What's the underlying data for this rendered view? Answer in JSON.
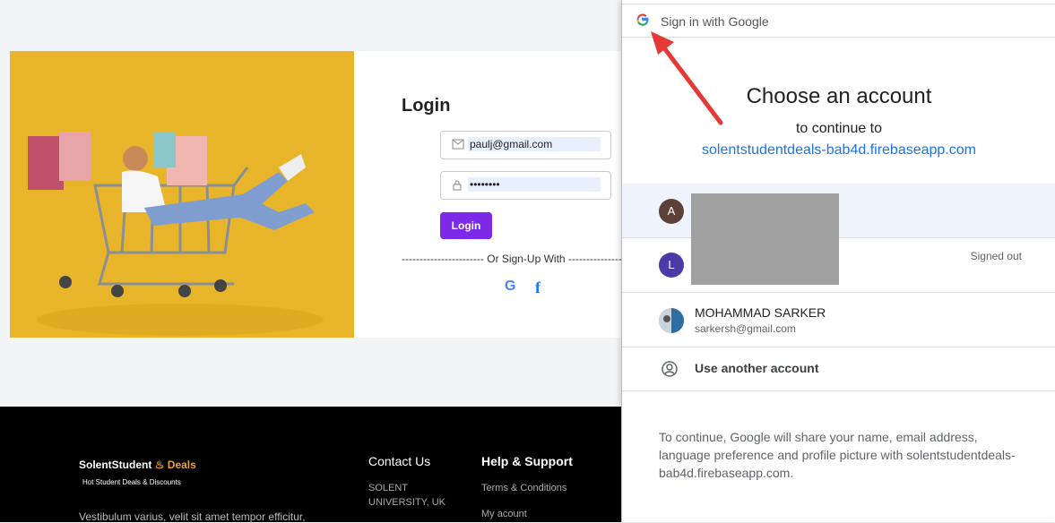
{
  "login": {
    "title": "Login",
    "email_value": "paulj@gmail.com",
    "password_value": "••••••••",
    "button_label": "Login",
    "divider": "----------------------- Or Sign-Up With ---------------------"
  },
  "social": {
    "google": "G",
    "facebook": "f"
  },
  "footer": {
    "logo_main": "SolentStudent",
    "logo_accent": "Deals",
    "tagline": "Hot Student Deals & Discounts",
    "description": "Vestibulum varius, velit sit amet tempor efficitur,",
    "contact_heading": "Contact Us",
    "contact_line1": "SOLENT",
    "contact_line2": "UNIVERSITY, UK",
    "help_heading": "Help & Support",
    "help_links": [
      "Terms & Conditions",
      "My acount"
    ]
  },
  "google_popup": {
    "bar_title": "Sign in with Google",
    "heading": "Choose an account",
    "subheading": "to continue to",
    "app_domain": "solentstudentdeals-bab4d.firebaseapp.com",
    "accounts": [
      {
        "initial": "A",
        "name": "",
        "email": "",
        "status": ""
      },
      {
        "initial": "L",
        "name": "",
        "email": "",
        "status": "Signed out"
      },
      {
        "initial": "",
        "name": "MOHAMMAD SARKER",
        "email": "sarkersh@gmail.com",
        "status": ""
      }
    ],
    "use_another": "Use another account",
    "note": "To continue, Google will share your name, email address, language preference and profile picture with solentstudentdeals-bab4d.firebaseapp.com."
  },
  "colors": {
    "accent_purple": "#7c2ae8",
    "google_blue": "#1a73e8",
    "hero_yellow": "#e8b52a",
    "annotation_red": "#e53935"
  }
}
